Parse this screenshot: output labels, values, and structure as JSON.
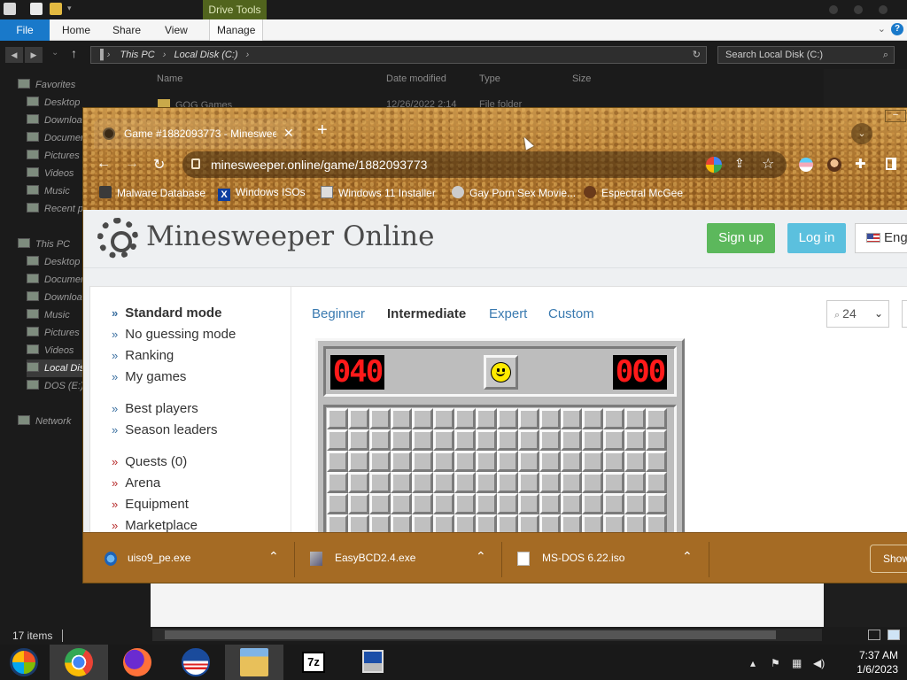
{
  "explorer": {
    "ribbon_tabs": [
      "File",
      "Home",
      "Share",
      "View",
      "Manage"
    ],
    "contextual_tab": "Drive Tools",
    "address_parts": [
      "This PC",
      "Local Disk (C:)"
    ],
    "search_placeholder": "Search Local Disk (C:)",
    "columns": [
      "Name",
      "Date modified",
      "Type",
      "Size"
    ],
    "first_row": {
      "name": "GOG Games",
      "date": "12/26/2022 2:14",
      "type": "File folder"
    },
    "sidebar": [
      {
        "label": "Favorites",
        "level": 0
      },
      {
        "label": "Desktop",
        "level": 1
      },
      {
        "label": "Downloads",
        "level": 1
      },
      {
        "label": "Documents",
        "level": 1
      },
      {
        "label": "Pictures",
        "level": 1
      },
      {
        "label": "Videos",
        "level": 1
      },
      {
        "label": "Music",
        "level": 1
      },
      {
        "label": "Recent places",
        "level": 1
      },
      {
        "label": "This PC",
        "level": 0
      },
      {
        "label": "Desktop",
        "level": 1
      },
      {
        "label": "Documents",
        "level": 1
      },
      {
        "label": "Downloads",
        "level": 1
      },
      {
        "label": "Music",
        "level": 1
      },
      {
        "label": "Pictures",
        "level": 1
      },
      {
        "label": "Videos",
        "level": 1
      },
      {
        "label": "Local Disk (C:)",
        "level": 1,
        "selected": true
      },
      {
        "label": "DOS (E:)",
        "level": 1
      },
      {
        "label": "Network",
        "level": 0
      }
    ],
    "status": "17 items"
  },
  "browser": {
    "tab_title": "Game #1882093773 - Minesweeper Online",
    "url": "minesweeper.online/game/1882093773",
    "bookmarks": [
      "Malware Database",
      "Windows ISOs",
      "Windows 11 Installer",
      "Gay Porn Sex Movie...",
      "Espectral McGee"
    ],
    "downloads": [
      "uiso9_pe.exe",
      "EasyBCD2.4.exe",
      "MS-DOS 6.22.iso"
    ],
    "show_all": "Show all",
    "theme_color": "#b7823a"
  },
  "site": {
    "title": "Minesweeper Online",
    "signup": "Sign up",
    "login": "Log in",
    "language": "English",
    "nav_group1": [
      "Standard mode",
      "No guessing mode",
      "Ranking",
      "My games"
    ],
    "nav_group2": [
      "Best players",
      "Season leaders"
    ],
    "nav_group3": [
      "Quests (0)",
      "Arena",
      "Equipment",
      "Marketplace"
    ],
    "levels": [
      "Beginner",
      "Intermediate",
      "Expert",
      "Custom"
    ],
    "active_level": "Intermediate",
    "zoom": "24",
    "mines_left": "040",
    "timer": "000",
    "grid_cols": 16,
    "grid_rows_visible": 6
  },
  "taskbar": {
    "time": "7:37 AM",
    "date": "1/6/2023"
  }
}
